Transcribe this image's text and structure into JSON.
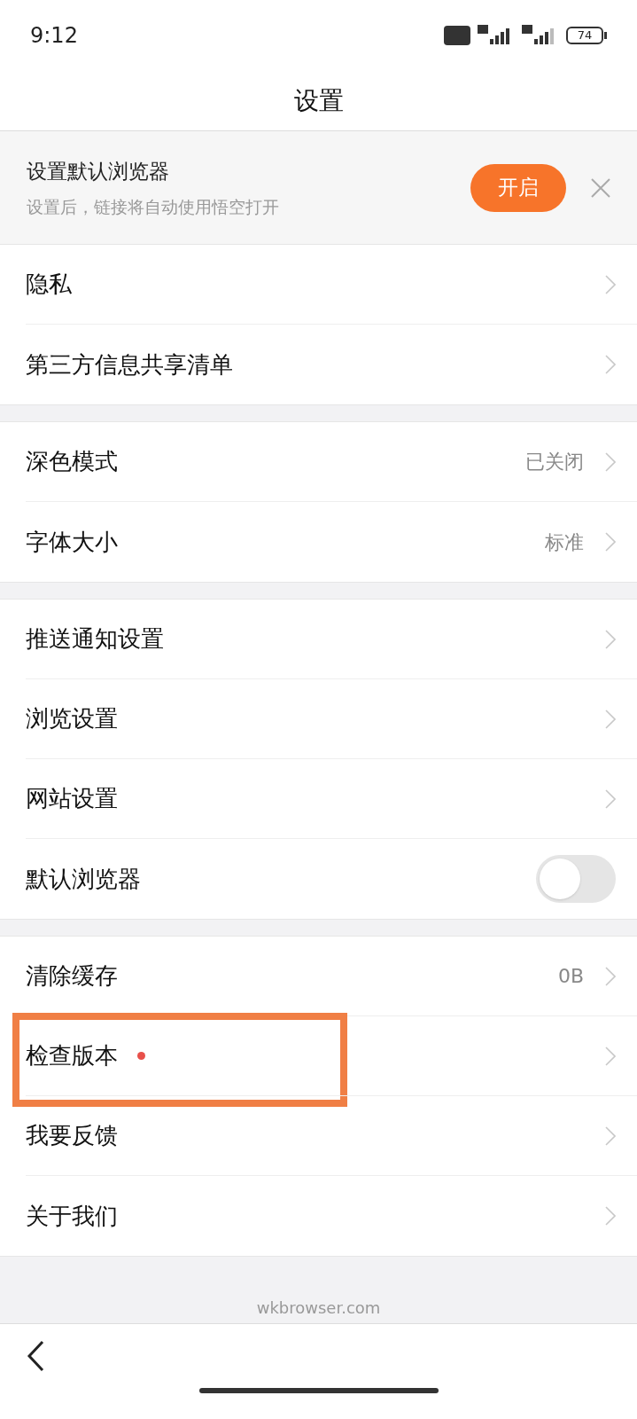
{
  "status_bar": {
    "time": "9:12",
    "battery": "74"
  },
  "title": "设置",
  "banner": {
    "title": "设置默认浏览器",
    "subtitle": "设置后，链接将自动使用悟空打开",
    "button": "开启"
  },
  "groups": [
    [
      {
        "kind": "link",
        "label": "隐私"
      },
      {
        "kind": "link",
        "label": "第三方信息共享清单"
      }
    ],
    [
      {
        "kind": "link",
        "label": "深色模式",
        "value": "已关闭"
      },
      {
        "kind": "link",
        "label": "字体大小",
        "value": "标准"
      }
    ],
    [
      {
        "kind": "link",
        "label": "推送通知设置"
      },
      {
        "kind": "link",
        "label": "浏览设置"
      },
      {
        "kind": "link",
        "label": "网站设置"
      },
      {
        "kind": "toggle",
        "label": "默认浏览器",
        "on": false
      }
    ],
    [
      {
        "kind": "link",
        "label": "清除缓存",
        "value": "0B"
      },
      {
        "kind": "link",
        "label": "检查版本",
        "badge": true,
        "highlighted": true
      },
      {
        "kind": "link",
        "label": "我要反馈"
      },
      {
        "kind": "link",
        "label": "关于我们"
      }
    ]
  ],
  "footer": "wkbrowser.com"
}
